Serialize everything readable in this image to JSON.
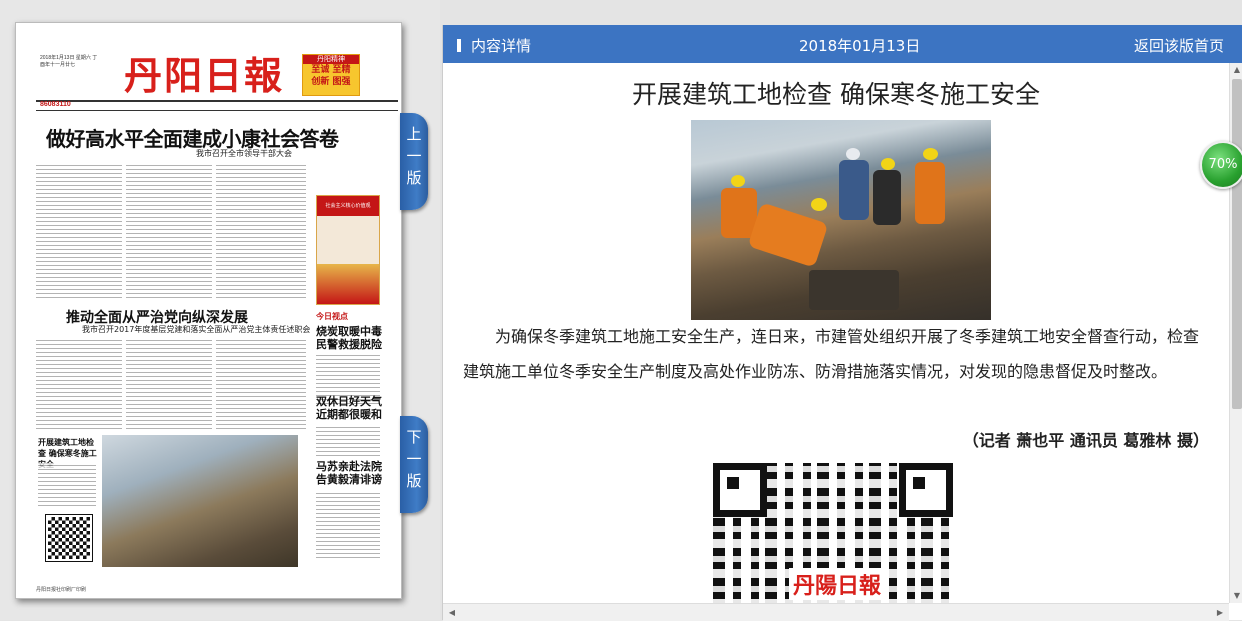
{
  "newspaper": {
    "masthead_title": "丹阳日報",
    "masthead_date": "2018年1月13日 星期六 丁酉年十一月廿七",
    "masthead_box_header": "丹阳精神",
    "masthead_box_row1": "至诚 至精",
    "masthead_box_row2": "创新 图强",
    "phone": "86083110",
    "headline": "做好高水平全面建成小康社会答卷",
    "sub_headline": "我市召开全市领导干部大会",
    "headline2": "推动全面从严治党向纵深发展",
    "sub_headline2": "我市召开2017年度基层党建和落实全面从严治党主体责任述职会",
    "ad_band": "社会主义核心价值观",
    "today_label": "今日视点",
    "side_head1": "烧炭取暖中毒 民警救援脱险",
    "side_head2": "双休日好天气 近期都很暖和",
    "side_head3": "马苏亲赴法院 告黄毅清诽谤",
    "small_head": "开展建筑工地检查 确保寒冬施工安全",
    "footer": "丹阳日报社印刷厂印刷"
  },
  "tabs": {
    "prev": [
      "上",
      "一",
      "版"
    ],
    "next": [
      "下",
      "一",
      "版"
    ]
  },
  "header": {
    "label": "内容详情",
    "date": "2018年01月13日",
    "back": "返回该版首页"
  },
  "article": {
    "title": "开展建筑工地检查 确保寒冬施工安全",
    "body": "为确保冬季建筑工地施工安全生产，连日来，市建管处组织开展了冬季建筑工地安全督查行动，检查建筑施工单位冬季安全生产制度及高处作业防冻、防滑措施落实情况，对发现的隐患督促及时整改。",
    "credit": "（记者 萧也平 通讯员 葛雅林 摄）",
    "qr_logo": "丹陽日報"
  },
  "progress": {
    "label": "70%",
    "value": 70
  },
  "colors": {
    "header_blue": "#3c74c2",
    "masthead_red": "#d8201b",
    "badge_green": "#29a12f"
  }
}
